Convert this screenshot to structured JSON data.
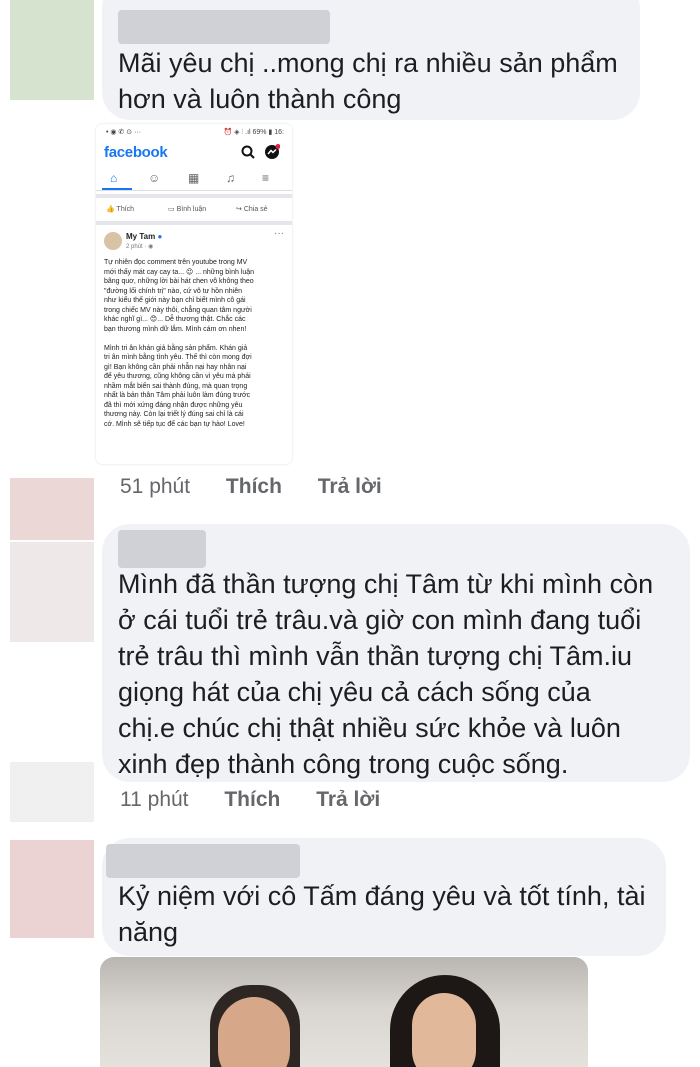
{
  "comments": [
    {
      "avatar_color": "#d6e4cf",
      "text": "Mãi yêu chị ..mong chị ra nhiều sản phẩm\nhơn và luôn thành công",
      "time": "51 phút",
      "like": "Thích",
      "reply": "Trả lời"
    },
    {
      "avatar_color": "#ecd7d7",
      "text": "Mình đã thần tượng chị Tâm từ khi mình còn\nở cái tuổi trẻ trâu.và giờ con mình đang tuổi\ntrẻ trâu thì mình vẫn thần tượng chị Tâm.iu\ngiọng hát của chị yêu cả cách sống của\nchị.e chúc chị thật nhiều sức khỏe và luôn\nxinh đẹp thành công trong cuộc sống.",
      "time": "11 phút",
      "like": "Thích",
      "reply": "Trả lời"
    },
    {
      "avatar_color": "#ecd3d3",
      "text": "Kỷ niệm với cô Tấm đáng yêu và tốt tính, tài\nnăng"
    }
  ],
  "screenshot": {
    "status_left": "• ◉ ✆ ⊙ ···",
    "status_right": "⏰ ◈ ⫶ .ıl 69% ▮ 16:",
    "app_name": "facebook",
    "like_label": "Thích",
    "comment_label": "Bình luận",
    "share_label": "Chia sẻ",
    "author": "My Tam",
    "post_time": "2 phút · ◉",
    "body": "Tự nhiên đọc comment trên youtube trong MV\nmới thấy mát cay cay ta... 😉 ... những bình luận\nbâng quơ, những lời bài hát chen vô không theo\n\"đường lối chính trị\" nào, cứ vô tư hồn nhiên\nnhư kiểu thế giới này bạn chỉ biết mình cô gái\ntrong chiếc MV này thôi, chẳng quan tâm người\nkhác nghĩ gì... 😊... Dễ thương thật. Chắc các\nbạn thương mình dữ lắm. Mình cám ơn nhen!\n\nMình tri ân khán giả bằng sản phẩm. Khán giả\ntri ân mình bằng tình yêu. Thế thì còn mong đợi\ngì! Bạn không cần phải nhẫn nại hay nhân nại\nđể yêu thương, cũng không cần vì yêu mà phải\nnhầm mắt biến sai thành đúng, mà quan trọng\nnhất là bản thân Tâm phải luôn làm đúng trước\nđã thì mới xứng đáng nhận được những yêu\nthương này. Còn lại triết lý đúng sai chỉ là cái\ncớ. Mình sẽ tiếp tục để các bạn tự hào! Love!"
  },
  "colors": {
    "bubble": "#f0f2f5",
    "facebook_blue": "#1877f2",
    "secondary_text": "#65676b"
  }
}
